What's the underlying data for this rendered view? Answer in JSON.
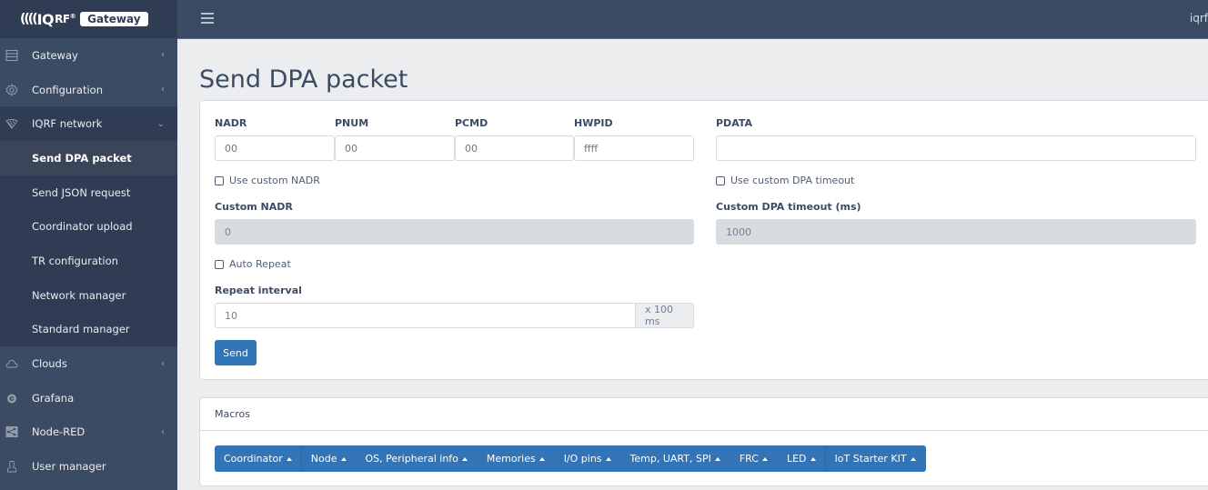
{
  "brand": {
    "logo_text": "IQRF",
    "badge": "Gateway"
  },
  "header": {
    "user": "iqrf"
  },
  "sidebar": {
    "items": [
      {
        "label": "Gateway",
        "icon": "server-icon",
        "expandable": true
      },
      {
        "label": "Configuration",
        "icon": "gear-icon",
        "expandable": true
      },
      {
        "label": "IQRF network",
        "icon": "network-icon",
        "expandable": true,
        "open": true
      },
      {
        "label": "Clouds",
        "icon": "cloud-icon",
        "expandable": true
      },
      {
        "label": "Grafana",
        "icon": "grafana-icon",
        "expandable": false
      },
      {
        "label": "Node-RED",
        "icon": "node-red-icon",
        "expandable": true
      },
      {
        "label": "User manager",
        "icon": "user-icon",
        "expandable": false
      }
    ],
    "subitems": [
      {
        "label": "Send DPA packet",
        "active": true
      },
      {
        "label": "Send JSON request"
      },
      {
        "label": "Coordinator upload"
      },
      {
        "label": "TR configuration"
      },
      {
        "label": "Network manager"
      },
      {
        "label": "Standard manager"
      }
    ]
  },
  "page": {
    "title": "Send DPA packet"
  },
  "form": {
    "nadr": {
      "label": "NADR",
      "value": "00"
    },
    "pnum": {
      "label": "PNUM",
      "value": "00"
    },
    "pcmd": {
      "label": "PCMD",
      "value": "00"
    },
    "hwpid": {
      "label": "HWPID",
      "value": "ffff"
    },
    "pdata": {
      "label": "PDATA",
      "value": ""
    },
    "use_custom_nadr": {
      "label": "Use custom NADR",
      "checked": false
    },
    "use_custom_timeout": {
      "label": "Use custom DPA timeout",
      "checked": false
    },
    "custom_nadr": {
      "label": "Custom NADR",
      "value": "0",
      "disabled": true
    },
    "custom_timeout": {
      "label": "Custom DPA timeout (ms)",
      "value": "1000",
      "disabled": true
    },
    "auto_repeat": {
      "label": "Auto Repeat",
      "checked": false
    },
    "repeat_interval": {
      "label": "Repeat interval",
      "value": "10",
      "suffix": "x 100 ms"
    },
    "send_label": "Send"
  },
  "macros": {
    "title": "Macros",
    "groups": [
      "Coordinator",
      "Node",
      "OS, Peripheral info",
      "Memories",
      "I/O pins",
      "Temp, UART, SPI",
      "FRC",
      "LED",
      "IoT Starter KIT"
    ]
  },
  "colors": {
    "sidebar_bg": "#3c4b64",
    "sidebar_dark": "#303c54",
    "primary": "#3274b5",
    "page_bg": "#ebedef"
  }
}
